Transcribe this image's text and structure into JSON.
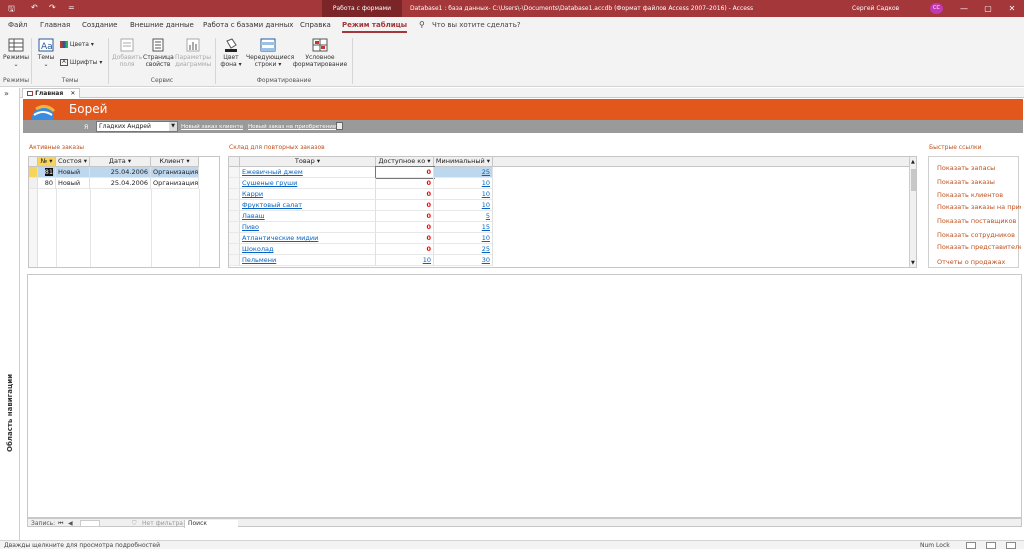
{
  "titlebar": {
    "context_tab": "Работа с формами",
    "title": "Database1 : база данных- C:\\Users\\-\\Documents\\Database1.accdb (Формат файлов Access 2007–2016)  -  Access",
    "user": "Сергей Садков",
    "initials": "СС",
    "minimize": "—",
    "restore": "▢",
    "close": "✕",
    "save_icon": "🖫",
    "undo_icon": "↶",
    "redo_icon": "↷",
    "customize": "="
  },
  "ribbon_tabs": [
    "Файл",
    "Главная",
    "Создание",
    "Внешние данные",
    "Работа с базами данных",
    "Справка",
    "Режим таблицы"
  ],
  "tell_me": "Что вы хотите сделать?",
  "tell_icon": "⚲",
  "ribbon": {
    "views": {
      "label": "Режимы",
      "group": "Режимы"
    },
    "themes": {
      "label": "Темы",
      "colors": "Цвета",
      "fonts": "Шрифты",
      "group": "Темы"
    },
    "tools": {
      "add_fields": "Добавить поля",
      "property_sheet": "Страница свойств",
      "chart_settings": "Параметры диаграммы",
      "group": "Сервис"
    },
    "formatting": {
      "fill": "Цвет фона",
      "alt_rows": "Чередующиеся строки",
      "conditional": "Условное форматирование",
      "group": "Форматирование"
    }
  },
  "nav": {
    "toggle": "»",
    "label": "Область навигации"
  },
  "doc_tab": {
    "label": "Главная",
    "close": "✕"
  },
  "form": {
    "title": "Борей",
    "me_label": "Я",
    "employee": "Гладких Андрей",
    "new_order": "Новый заказ клиента",
    "new_purchase": "Новый заказ на приобретение"
  },
  "active_orders": {
    "title": "Активные заказы",
    "columns": [
      "№",
      "Состоя",
      "Дата",
      "Клиент"
    ],
    "rows": [
      {
        "num": "81",
        "status": "Новый",
        "date": "25.04.2006",
        "client": "Организация"
      },
      {
        "num": "80",
        "status": "Новый",
        "date": "25.04.2006",
        "client": "Организация"
      }
    ]
  },
  "reorder": {
    "title": "Склад для повторных заказов",
    "columns": [
      "Товар",
      "Доступное ко",
      "Минимальный"
    ],
    "rows": [
      {
        "product": "Ежевичный джем",
        "available": "0",
        "minimum": "25"
      },
      {
        "product": "Сушеные груши",
        "available": "0",
        "minimum": "10"
      },
      {
        "product": "Карри",
        "available": "0",
        "minimum": "10"
      },
      {
        "product": "Фруктовый салат",
        "available": "0",
        "minimum": "10"
      },
      {
        "product": "Лаваш",
        "available": "0",
        "minimum": "5"
      },
      {
        "product": "Пиво",
        "available": "0",
        "minimum": "15"
      },
      {
        "product": "Атлантические мидии",
        "available": "0",
        "minimum": "10"
      },
      {
        "product": "Шоколад",
        "available": "0",
        "minimum": "25"
      },
      {
        "product": "Пельмени",
        "available": "10",
        "minimum": "30"
      }
    ]
  },
  "quick_links": {
    "title": "Быстрые ссылки",
    "items": [
      "Показать запасы",
      "Показать заказы",
      "Показать клиентов",
      "Показать заказы на приобретение",
      "Показать поставщиков",
      "Показать сотрудников",
      "Показать представителей",
      "Отчеты о продажах"
    ]
  },
  "record_nav": {
    "label": "Запись:",
    "first": "⏮",
    "prev": "◀",
    "filter": "Нет фильтра",
    "search": "Поиск"
  },
  "status": {
    "text": "Дважды щелкните для просмотра подробностей",
    "numlock": "Num Lock"
  }
}
